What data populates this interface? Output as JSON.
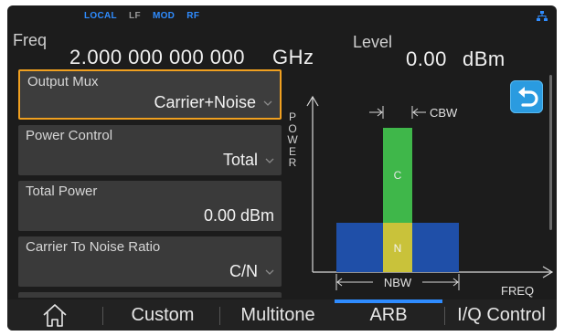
{
  "status": {
    "local": "LOCAL",
    "lf": "LF",
    "mod": "MOD",
    "rf": "RF"
  },
  "header": {
    "freq_label": "Freq",
    "freq_value": "2.000 000 000 000",
    "freq_unit": "GHz",
    "level_label": "Level",
    "level_value": "0.00",
    "level_unit": "dBm"
  },
  "params": [
    {
      "label": "Output Mux",
      "value": "Carrier+Noise",
      "selected": true
    },
    {
      "label": "Power Control",
      "value": "Total"
    },
    {
      "label": "Total Power",
      "value": "0.00 dBm"
    },
    {
      "label": "Carrier To Noise Ratio",
      "value": "C/N"
    }
  ],
  "diagram": {
    "y_axis_label": "POWER",
    "x_axis_label": "FREQ",
    "cbw_label": "CBW",
    "nbw_label": "NBW",
    "carrier_label": "C",
    "noise_label": "N",
    "colors": {
      "carrier": "#3fb74a",
      "noise": "#1f4fa8",
      "overlap": "#c9c23a",
      "axis": "#d8d8d8"
    }
  },
  "nav": {
    "home": "home",
    "custom": "Custom",
    "multitone": "Multitone",
    "arb": "ARB",
    "iq": "I/Q Control",
    "active": "ARB"
  }
}
